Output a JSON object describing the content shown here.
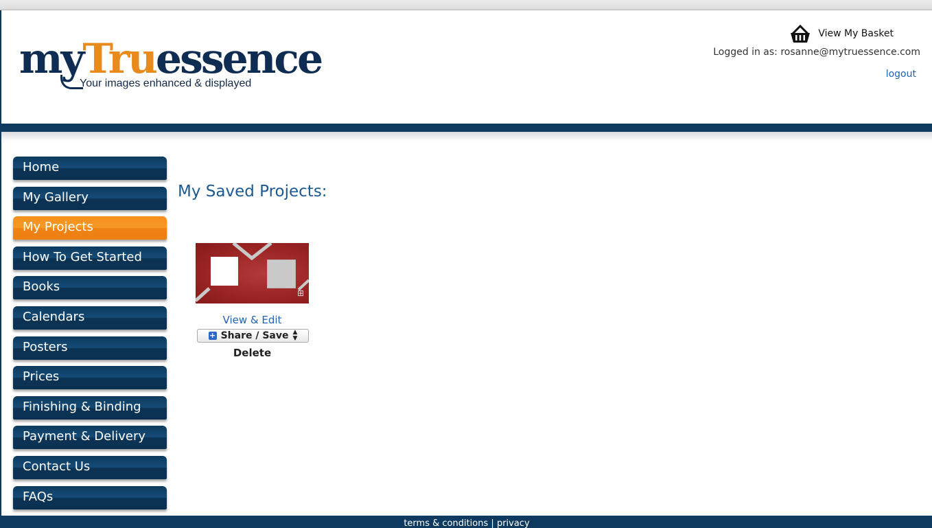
{
  "header": {
    "logo": {
      "part1": "my",
      "part2": "Tru",
      "part3": "essence",
      "tagline": "Your images enhanced & displayed"
    },
    "basket_label": "View My Basket",
    "logged_in_prefix": "Logged in as:",
    "user_email": "rosanne@mytruessence.com",
    "logout_label": "logout"
  },
  "nav": {
    "items": [
      {
        "label": "Home",
        "active": false
      },
      {
        "label": "My Gallery",
        "active": false
      },
      {
        "label": "My Projects",
        "active": true
      },
      {
        "label": "How To Get Started",
        "active": false
      },
      {
        "label": "Books",
        "active": false
      },
      {
        "label": "Calendars",
        "active": false
      },
      {
        "label": "Posters",
        "active": false
      },
      {
        "label": "Prices",
        "active": false
      },
      {
        "label": "Finishing & Binding",
        "active": false
      },
      {
        "label": "Payment & Delivery",
        "active": false
      },
      {
        "label": "Contact Us",
        "active": false
      },
      {
        "label": "FAQs",
        "active": false
      }
    ]
  },
  "main": {
    "title": "My Saved Projects:",
    "project": {
      "view_edit_label": "View & Edit",
      "share_save_label": "Share / Save",
      "delete_label": "Delete"
    }
  },
  "footer": {
    "terms_label": "terms & conditions",
    "separator": "|",
    "privacy_label": "privacy"
  },
  "colors": {
    "navy": "#0e3a5f",
    "accent_orange": "#f68e1c",
    "link_blue": "#1f63b3",
    "title_blue": "#1d5a93"
  },
  "icons": {
    "basket": "basket-icon",
    "share_plus": "plus-square-icon",
    "select_arrows": "updown-arrows-icon"
  }
}
